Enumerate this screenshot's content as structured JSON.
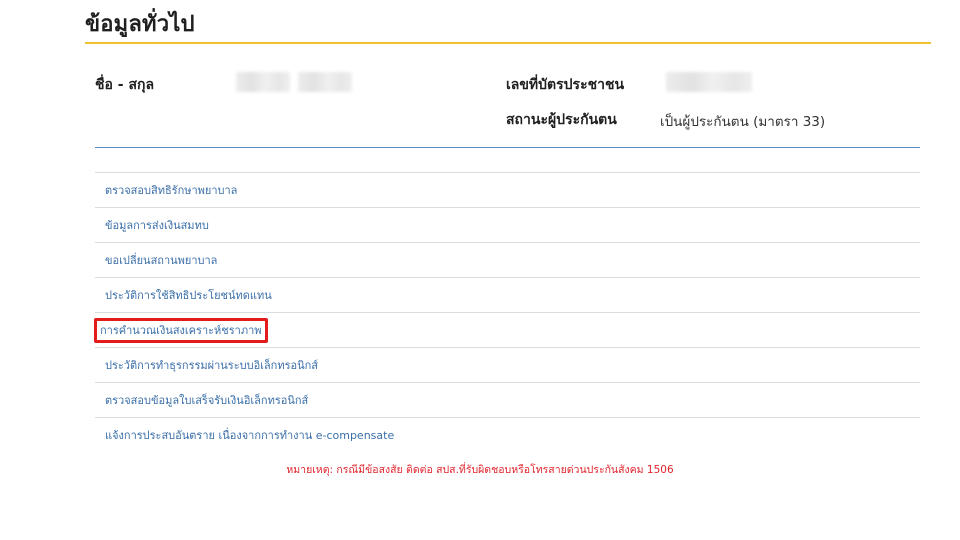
{
  "page": {
    "title": "ข้อมูลทั่วไป"
  },
  "info": {
    "name_label": "ชื่อ - สกุล",
    "id_card_label": "เลขที่บัตรประชาชน",
    "status_label": "สถานะผู้ประกันตน",
    "status_value": "เป็นผู้ประกันตน (มาตรา 33)"
  },
  "menu": {
    "items": [
      {
        "label": "ตรวจสอบสิทธิรักษาพยาบาล"
      },
      {
        "label": "ข้อมูลการส่งเงินสมทบ"
      },
      {
        "label": "ขอเปลี่ยนสถานพยาบาล"
      },
      {
        "label": "ประวัติการใช้สิทธิประโยชน์ทดแทน"
      },
      {
        "label": "การคำนวณเงินสงเคราะห์ชราภาพ",
        "highlighted": true
      },
      {
        "label": "ประวัติการทำธุรกรรมผ่านระบบอิเล็กทรอนิกส์"
      },
      {
        "label": "ตรวจสอบข้อมูลใบเสร็จรับเงินอิเล็กทรอนิกส์"
      },
      {
        "label": "แจ้งการประสบอันตราย เนื่องจากการทำงาน e-compensate"
      }
    ]
  },
  "footnote": {
    "text": "หมายเหตุ: กรณีมีข้อสงสัย ติดต่อ สปส.ที่รับผิดชอบหรือโทรสายด่วนประกันสังคม 1506"
  },
  "colors": {
    "accent_rule": "#f2c12e",
    "link": "#3b6fa8",
    "highlight_box": "#e31b1b",
    "footnote": "#e0242c"
  }
}
